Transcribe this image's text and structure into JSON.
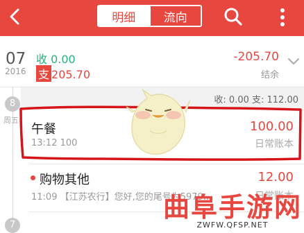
{
  "header": {
    "tab_detail": "明细",
    "tab_flow": "流向"
  },
  "summary": {
    "month": "07",
    "year": "2016",
    "income": "收 0.00",
    "expense_label": "支",
    "expense_value": "205.70",
    "total": "-205.70",
    "total_label": "结余"
  },
  "days": [
    {
      "day": "8",
      "weekday": "周五",
      "summary": "收: 0.00 支: 112.00",
      "entries": [
        {
          "title": "午餐",
          "time": "13:12",
          "note": "100",
          "amount": "100.00",
          "account": "日常账本"
        },
        {
          "title": "购物其他",
          "time": "11:09",
          "note": "【江苏农行】您好,您的尾号为5979...",
          "amount": "12.00",
          "account": "日常账本"
        }
      ]
    },
    {
      "day": "7"
    }
  ],
  "watermark": {
    "main": "曲阜手游网",
    "sub": "ZWFW.QFSP.NET"
  },
  "colors": {
    "brand": "#e8473f",
    "income": "#24b37a"
  }
}
